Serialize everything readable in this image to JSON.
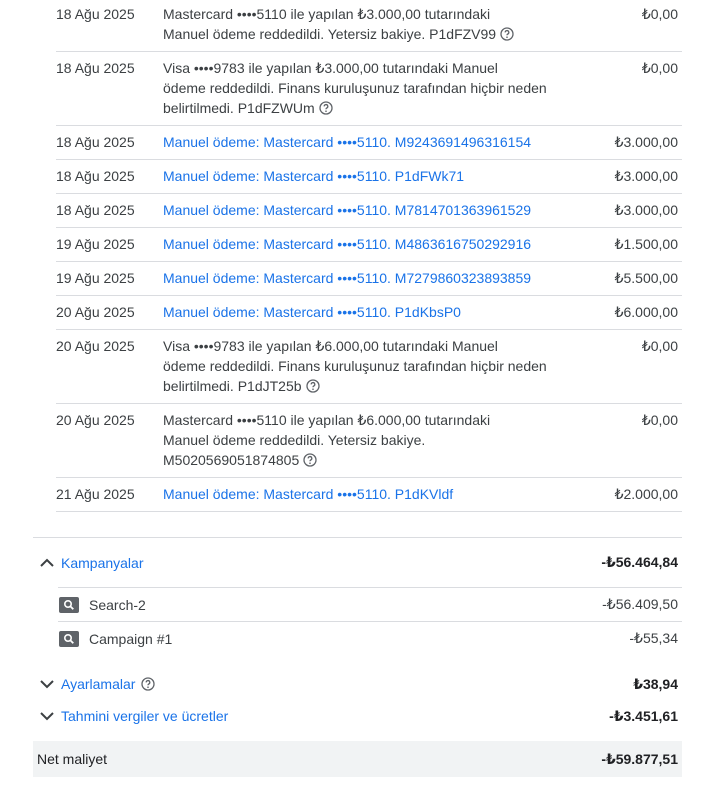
{
  "transactions": [
    {
      "date": "18 Ağu 2025",
      "parts": [
        {
          "t": "Mastercard ••••5110 ile yapılan ₺3.000,00 tutarındaki"
        },
        {
          "br": true
        },
        {
          "t": "Manuel ödeme reddedildi. Yetersiz bakiye. P1dFZV99"
        }
      ],
      "help": true,
      "amount": "₺0,00"
    },
    {
      "date": "18 Ağu 2025",
      "parts": [
        {
          "t": "Visa ••••9783 ile yapılan ₺3.000,00 tutarındaki Manuel"
        },
        {
          "br": true
        },
        {
          "t": "ödeme reddedildi. Finans kuruluşunuz tarafından hiçbir neden"
        },
        {
          "br": true
        },
        {
          "t": "belirtilmedi. P1dFZWUm"
        }
      ],
      "help": true,
      "amount": "₺0,00"
    },
    {
      "date": "18 Ağu 2025",
      "link": "Manuel ödeme: Mastercard ••••5110. M9243691496316154",
      "amount": "₺3.000,00"
    },
    {
      "date": "18 Ağu 2025",
      "link": "Manuel ödeme: Mastercard ••••5110. P1dFWk71",
      "amount": "₺3.000,00"
    },
    {
      "date": "18 Ağu 2025",
      "link": "Manuel ödeme: Mastercard ••••5110. M7814701363961529",
      "amount": "₺3.000,00"
    },
    {
      "date": "19 Ağu 2025",
      "link": "Manuel ödeme: Mastercard ••••5110. M4863616750292916",
      "amount": "₺1.500,00"
    },
    {
      "date": "19 Ağu 2025",
      "link": "Manuel ödeme: Mastercard ••••5110. M7279860323893859",
      "amount": "₺5.500,00"
    },
    {
      "date": "20 Ağu 2025",
      "link": "Manuel ödeme: Mastercard ••••5110. P1dKbsP0",
      "amount": "₺6.000,00"
    },
    {
      "date": "20 Ağu 2025",
      "parts": [
        {
          "t": "Visa ••••9783 ile yapılan ₺6.000,00 tutarındaki Manuel"
        },
        {
          "br": true
        },
        {
          "t": "ödeme reddedildi. Finans kuruluşunuz tarafından hiçbir neden"
        },
        {
          "br": true
        },
        {
          "t": "belirtilmedi. P1dJT25b"
        }
      ],
      "help": true,
      "amount": "₺0,00"
    },
    {
      "date": "20 Ağu 2025",
      "parts": [
        {
          "t": "Mastercard ••••5110 ile yapılan ₺6.000,00 tutarındaki"
        },
        {
          "br": true
        },
        {
          "t": "Manuel ödeme reddedildi. Yetersiz bakiye."
        },
        {
          "br": true
        },
        {
          "t": "M5020569051874805"
        }
      ],
      "help": true,
      "amount": "₺0,00"
    },
    {
      "date": "21 Ağu 2025",
      "link": "Manuel ödeme: Mastercard ••••5110. P1dKVldf",
      "amount": "₺2.000,00"
    }
  ],
  "summary": {
    "campaigns": {
      "label": "Kampanyalar",
      "value": "-₺56.464,84",
      "expanded": true,
      "items": [
        {
          "name": "Search-2",
          "value": "-₺56.409,50",
          "icon": "search-icon"
        },
        {
          "name": "Campaign #1",
          "value": "-₺55,34",
          "icon": "search-icon"
        }
      ]
    },
    "adjustments": {
      "label": "Ayarlamalar",
      "value": "₺38,94",
      "help": true
    },
    "taxes": {
      "label": "Tahmini vergiler ve ücretler",
      "value": "-₺3.451,61"
    },
    "net": {
      "label": "Net maliyet",
      "value": "-₺59.877,51"
    }
  },
  "colors": {
    "link": "#1a73e8",
    "text": "#3c4043",
    "divider": "#dadce0",
    "net_bg": "#f1f3f4"
  }
}
